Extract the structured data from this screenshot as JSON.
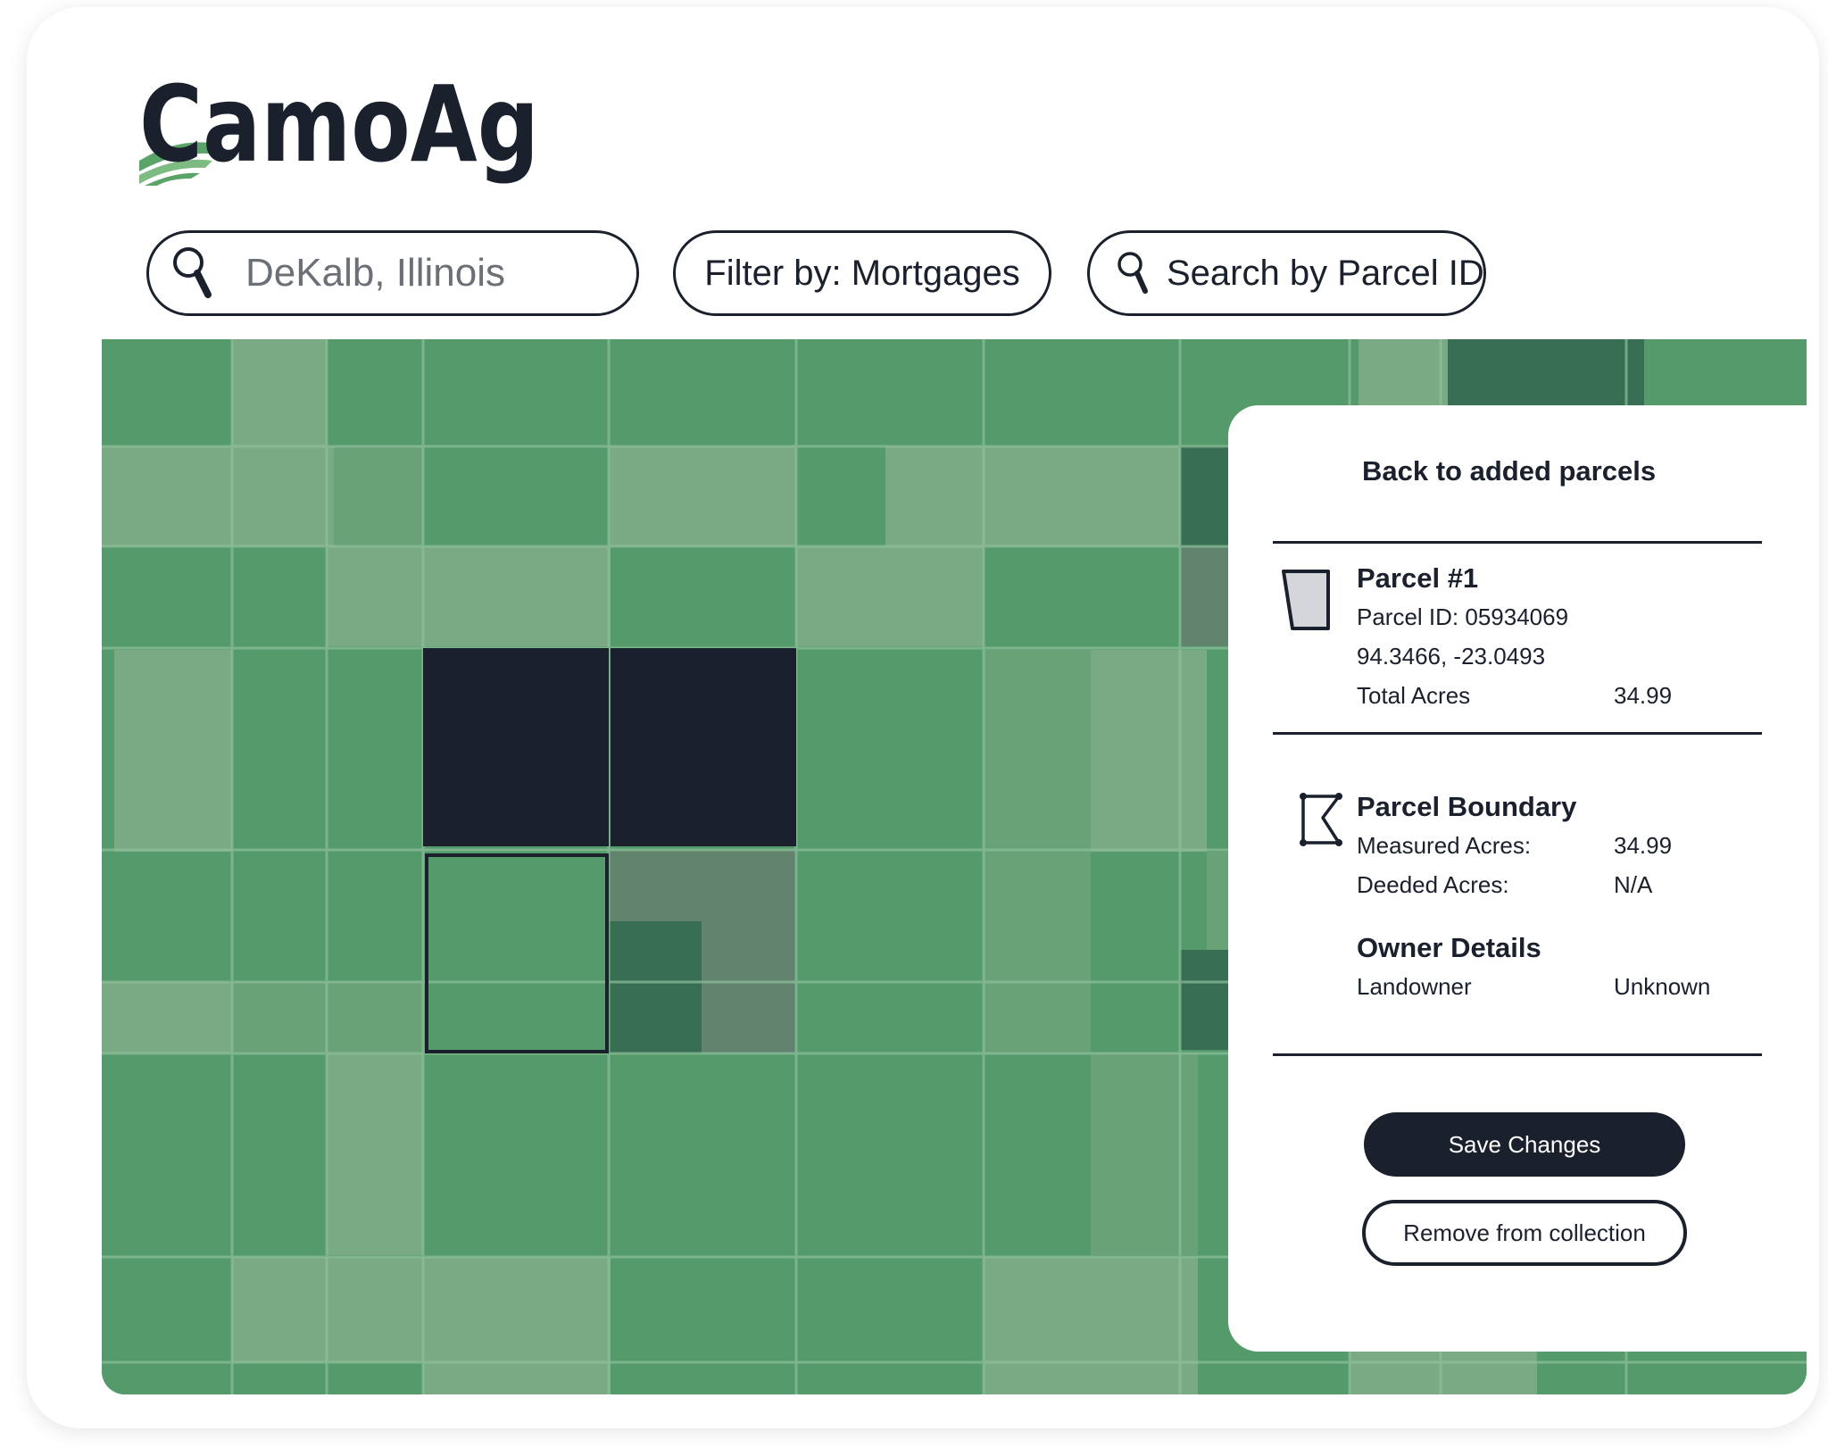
{
  "app": {
    "brand_name": "CamoAg"
  },
  "toolbar": {
    "location_search": {
      "value": "DeKalb, Illinois",
      "placeholder": "DeKalb, Illinois",
      "icon": "search-icon"
    },
    "filter_label": "Filter by: Mortgages",
    "parcel_search_placeholder": "Search by Parcel ID"
  },
  "map": {
    "colors": {
      "field_base": "#549a6b",
      "field_light": "#7aaa84",
      "field_mid": "#68a276",
      "field_dark": "#386f54",
      "field_muted": "#62846f",
      "selected_parcel": "#1a202c",
      "gridline": "#8ec09c"
    }
  },
  "panel": {
    "back_link": "Back to added parcels",
    "parcel": {
      "title": "Parcel #1",
      "id_label": "Parcel ID: 05934069",
      "coordinates": "94.3466,  -23.0493",
      "total_acres_label": "Total Acres",
      "total_acres_value": "34.99",
      "icon": "parcel-shape-icon"
    },
    "boundary": {
      "title": "Parcel Boundary",
      "measured_label": "Measured Acres:",
      "measured_value": "34.99",
      "deeded_label": "Deeded Acres:",
      "deeded_value": "N/A",
      "icon": "boundary-polygon-icon"
    },
    "owner": {
      "title": "Owner Details",
      "landowner_label": "Landowner",
      "landowner_value": "Unknown"
    },
    "actions": {
      "save_label": "Save Changes",
      "remove_label": "Remove from collection"
    }
  }
}
